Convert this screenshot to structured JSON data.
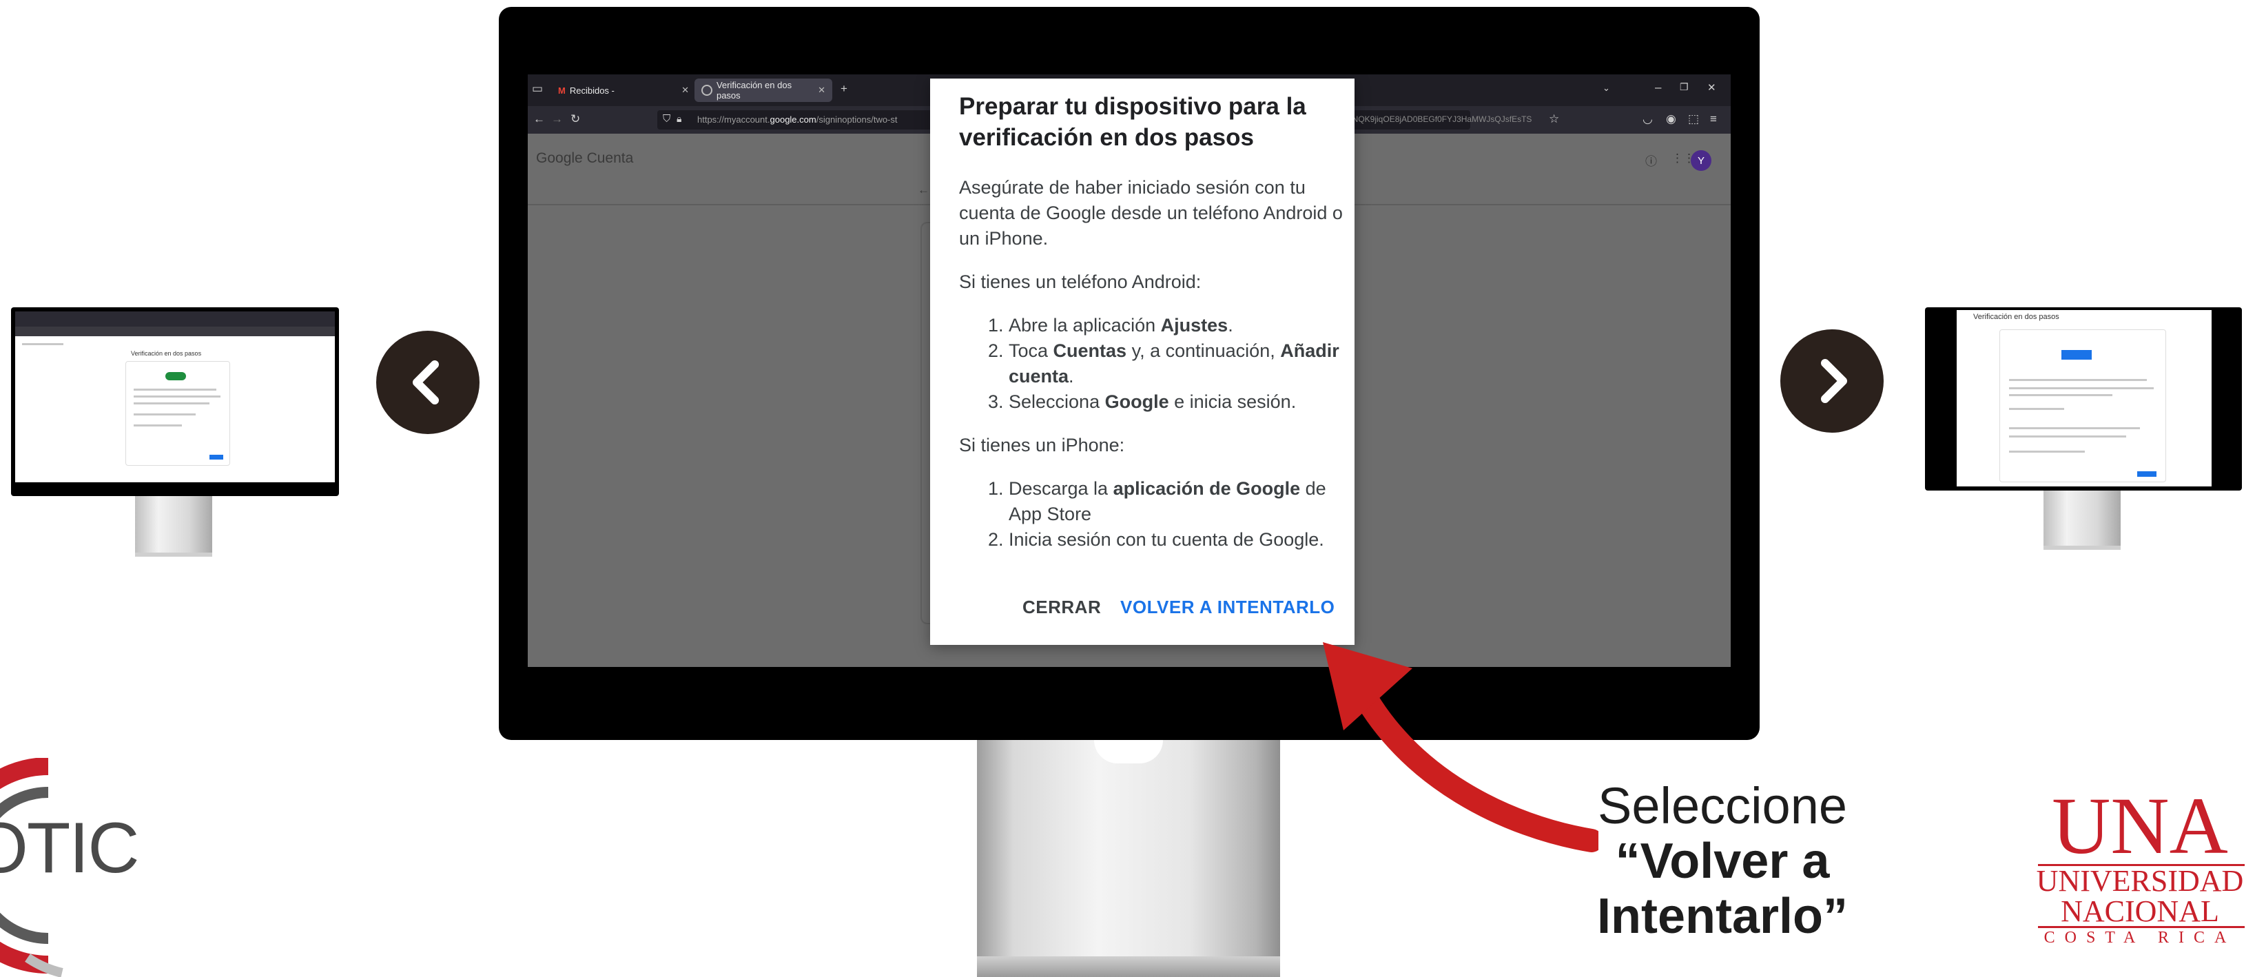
{
  "browser": {
    "tabs": [
      {
        "label": "Recibidos -"
      },
      {
        "label": "Verificación en dos pasos"
      }
    ],
    "new_tab": "+",
    "url_prefix": "https://myaccount.",
    "url_domain": "google.com",
    "url_path": "/signinoptions/two-st",
    "url_tail": "7NQK9jiqOE8jAD0BEGf0FYJ3HaMWJsQJsfEsTS"
  },
  "google_header": {
    "logo_word": "Google",
    "product": "Cuenta",
    "avatar_letter": "Y"
  },
  "dialog": {
    "title": "Preparar tu dispositivo para la verificación en dos pasos",
    "intro": "Asegúrate de haber iniciado sesión con tu cuenta de Google desde un teléfono Android o un iPhone.",
    "android_heading": "Si tienes un teléfono Android:",
    "android_steps": [
      {
        "before": "Abre la aplicación ",
        "bold": "Ajustes",
        "after": "."
      },
      {
        "before": "Toca ",
        "bold": "Cuentas",
        "middle": " y, a continuación, ",
        "bold2": "Añadir cuenta",
        "after": "."
      },
      {
        "before": "Selecciona ",
        "bold": "Google",
        "after": " e inicia sesión."
      }
    ],
    "iphone_heading": "Si tienes un iPhone:",
    "iphone_steps": [
      {
        "before": "Descarga la ",
        "bold": "aplicación de Google",
        "after": " de App Store"
      },
      {
        "text": "Inicia sesión con tu cuenta de Google."
      }
    ],
    "close_label": "CERRAR",
    "retry_label": "VOLVER A INTENTARLO"
  },
  "mini_left": {
    "heading": "Verificación en dos pasos"
  },
  "mini_right": {
    "heading": "Verificación en dos pasos"
  },
  "annotation": {
    "line1": "Seleccione",
    "line2": "“Volver a",
    "line3": "Intentarlo”"
  },
  "logos": {
    "otic_text": "OTIC",
    "una_line1": "UNA",
    "una_line2": "UNIVERSIDAD",
    "una_line3": "NACIONAL",
    "una_line4": "COSTA RICA"
  },
  "colors": {
    "accent_blue": "#1a73e8",
    "arrow_red": "#cc1f1f",
    "una_red": "#c8202a",
    "nav_button": "#2b211c"
  }
}
